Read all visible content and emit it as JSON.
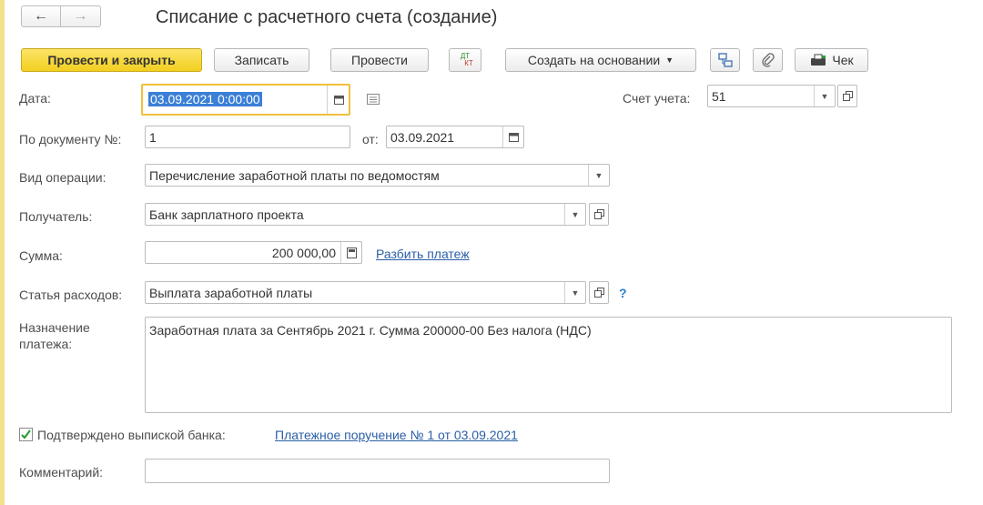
{
  "header": {
    "title": "Списание с расчетного счета (создание)",
    "back_icon": "arrow-left-icon",
    "forward_icon": "arrow-right-icon"
  },
  "toolbar": {
    "post_close": "Провести и закрыть",
    "save": "Записать",
    "post": "Провести",
    "dtkt_top": "ДТ",
    "dtkt_bottom": "КТ",
    "create_based": "Создать на основании",
    "receipt": "Чек"
  },
  "form": {
    "date_label": "Дата:",
    "date_value": "03.09.2021  0:00:00",
    "account_label": "Счет учета:",
    "account_value": "51",
    "docnum_label": "По документу №:",
    "docnum_value": "1",
    "from_label": "от:",
    "from_value": "03.09.2021",
    "optype_label": "Вид операции:",
    "optype_value": "Перечисление заработной платы по ведомостям",
    "recipient_label": "Получатель:",
    "recipient_value": "Банк зарплатного проекта",
    "sum_label": "Сумма:",
    "sum_value": "200 000,00",
    "split_link": "Разбить платеж",
    "expense_label": "Статья расходов:",
    "expense_value": "Выплата заработной платы",
    "help_mark": "?",
    "purpose_label_1": "Назначение",
    "purpose_label_2": "платежа:",
    "purpose_value": "Заработная плата за Сентябрь 2021 г. Сумма 200000-00 Без налога (НДС)",
    "confirmed_label": "Подтверждено выпиской банка:",
    "confirmed_link": "Платежное поручение № 1 от 03.09.2021",
    "comment_label": "Комментарий:",
    "comment_value": ""
  },
  "colors": {
    "accent": "#f2cf1f",
    "link": "#2a5ea7",
    "focus": "#f0c03a"
  }
}
